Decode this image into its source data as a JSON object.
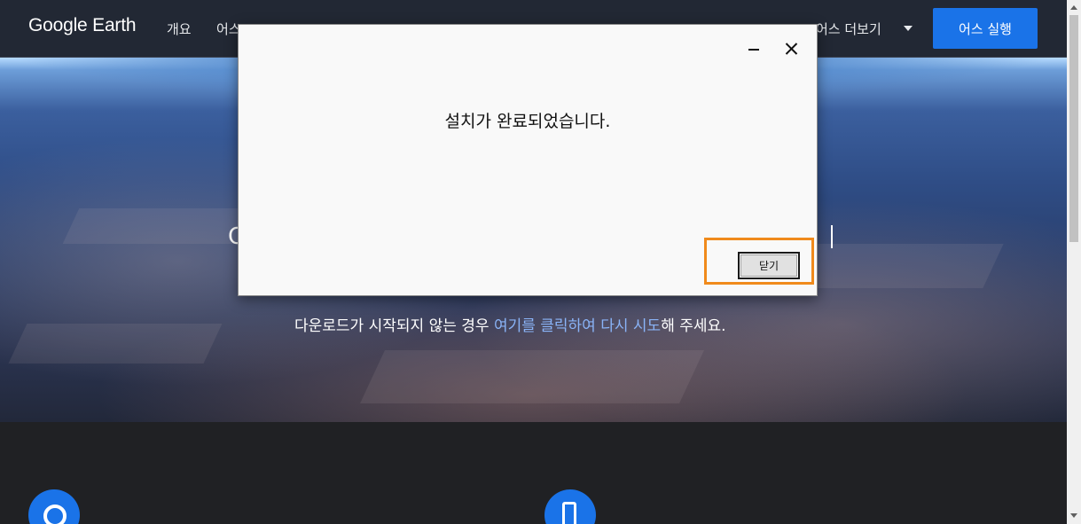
{
  "header": {
    "logo_text": "Google Earth",
    "nav": {
      "overview": "개요",
      "earth_partial": "어스",
      "more": "어스 더보기"
    },
    "launch_button": "어스 실행"
  },
  "hero": {
    "left_char": "C",
    "right_char": "_",
    "download_note": {
      "prefix": "다운로드가 시작되지 않는 경우 ",
      "link": "여기를 클릭하여 다시 시도",
      "suffix": "해 주세요."
    }
  },
  "dialog": {
    "message": "설치가 완료되었습니다.",
    "close_button": "닫기"
  },
  "colors": {
    "brand_blue": "#1a73e8",
    "header_bg": "#222834",
    "link": "#8ab4f8",
    "highlight": "#f08a1c"
  },
  "icons": [
    "chevron-down-icon",
    "minimize-icon",
    "close-icon",
    "chrome-icon",
    "mobile-icon",
    "scroll-up-icon",
    "scroll-down-icon"
  ]
}
